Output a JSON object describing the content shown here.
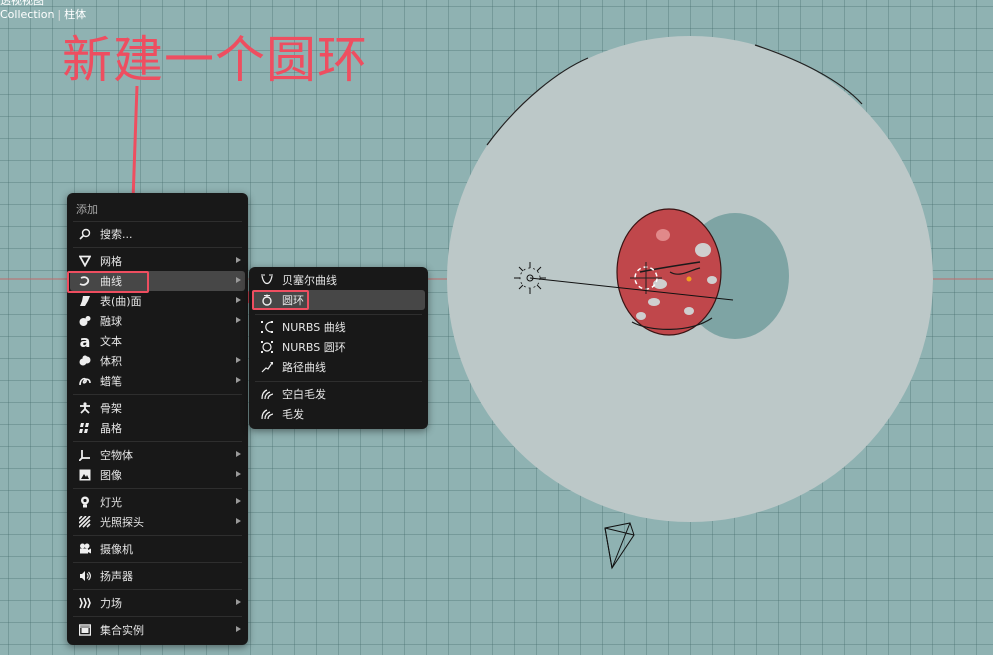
{
  "viewport": {
    "header_text": "透视视图",
    "collection": "Collection",
    "object": "柱体"
  },
  "annotation": {
    "text": "新建一个圆环"
  },
  "add_menu": {
    "title": "添加",
    "items": [
      {
        "label": "搜索...",
        "icon": "search-icon"
      },
      {
        "label": "网格",
        "icon": "mesh-icon",
        "submenu": true
      },
      {
        "label": "曲线",
        "icon": "curve-icon",
        "submenu": true,
        "highlighted": true
      },
      {
        "label": "表(曲)面",
        "icon": "surface-icon",
        "submenu": true
      },
      {
        "label": "融球",
        "icon": "metaball-icon",
        "submenu": true
      },
      {
        "label": "文本",
        "icon": "text-icon"
      },
      {
        "label": "体积",
        "icon": "volume-icon",
        "submenu": true
      },
      {
        "label": "蜡笔",
        "icon": "grease-pencil-icon",
        "submenu": true
      },
      {
        "label": "骨架",
        "icon": "armature-icon"
      },
      {
        "label": "晶格",
        "icon": "lattice-icon"
      },
      {
        "label": "空物体",
        "icon": "empty-icon",
        "submenu": true
      },
      {
        "label": "图像",
        "icon": "image-icon",
        "submenu": true
      },
      {
        "label": "灯光",
        "icon": "light-icon",
        "submenu": true
      },
      {
        "label": "光照探头",
        "icon": "light-probe-icon",
        "submenu": true
      },
      {
        "label": "摄像机",
        "icon": "camera-icon"
      },
      {
        "label": "扬声器",
        "icon": "speaker-icon"
      },
      {
        "label": "力场",
        "icon": "force-field-icon",
        "submenu": true
      },
      {
        "label": "集合实例",
        "icon": "collection-instance-icon",
        "submenu": true
      }
    ]
  },
  "curve_submenu": {
    "items": [
      {
        "label": "贝塞尔曲线",
        "icon": "bezier-curve-icon"
      },
      {
        "label": "圆环",
        "icon": "bezier-circle-icon",
        "highlighted": true
      },
      {
        "label": "NURBS 曲线",
        "icon": "nurbs-curve-icon"
      },
      {
        "label": "NURBS 圆环",
        "icon": "nurbs-circle-icon"
      },
      {
        "label": "路径曲线",
        "icon": "path-curve-icon"
      },
      {
        "label": "空白毛发",
        "icon": "empty-hair-icon"
      },
      {
        "label": "毛发",
        "icon": "hair-icon"
      }
    ]
  },
  "colors": {
    "annotation_red": "#ee4e60",
    "viewport_bg": "#8fb2b2",
    "menu_bg": "#181818",
    "highlight": "#474747",
    "disc": "#bcc8c8",
    "ball": "#c0474b"
  }
}
